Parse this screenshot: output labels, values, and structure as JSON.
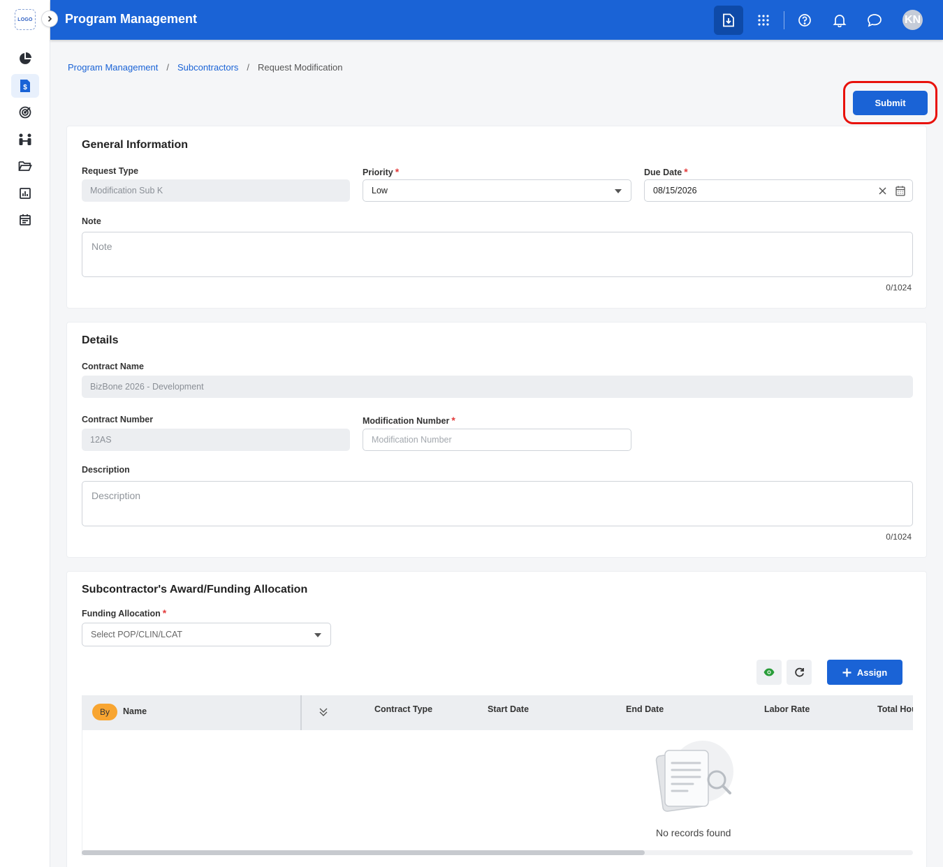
{
  "app": {
    "logo_text": "LOGO",
    "title": "Program Management"
  },
  "topbar": {
    "icons": [
      "download-file-icon",
      "apps-grid-icon",
      "help-icon",
      "bell-icon",
      "chat-icon"
    ],
    "avatar_initials": "KN",
    "accent_color": "#1a63d6"
  },
  "sidebar": {
    "items": [
      {
        "name": "dashboard-icon"
      },
      {
        "name": "contracts-icon",
        "active": true
      },
      {
        "name": "goals-icon"
      },
      {
        "name": "people-icon"
      },
      {
        "name": "folder-icon"
      },
      {
        "name": "reports-icon"
      },
      {
        "name": "calendar-icon"
      }
    ]
  },
  "breadcrumb": {
    "items": [
      "Program Management",
      "Subcontractors",
      "Request Modification"
    ],
    "separator": "/"
  },
  "actions": {
    "submit_label": "Submit"
  },
  "general_info": {
    "title": "General Information",
    "request_type": {
      "label": "Request Type",
      "value": "Modification Sub K"
    },
    "priority": {
      "label": "Priority",
      "value": "Low",
      "required_mark": "*"
    },
    "due_date": {
      "label": "Due Date",
      "value": "08/15/2026",
      "required_mark": "*"
    },
    "note": {
      "label": "Note",
      "placeholder": "Note",
      "counter": "0/1024"
    }
  },
  "details": {
    "title": "Details",
    "contract_name": {
      "label": "Contract Name",
      "value": "BizBone 2026 - Development"
    },
    "contract_number": {
      "label": "Contract Number",
      "value": "12AS"
    },
    "modification_number": {
      "label": "Modification Number",
      "placeholder": "Modification Number",
      "required_mark": "*"
    },
    "description": {
      "label": "Description",
      "placeholder": "Description",
      "counter": "0/1024"
    }
  },
  "funding": {
    "title": "Subcontractor's Award/Funding Allocation",
    "allocation": {
      "label": "Funding Allocation",
      "placeholder": "Select POP/CLIN/LCAT",
      "required_mark": "*"
    },
    "assign_label": "Assign",
    "table": {
      "by_badge": "By",
      "columns": [
        "Name",
        "Contract Type",
        "Start Date",
        "End Date",
        "Labor Rate",
        "Total Hours"
      ],
      "empty_text": "No records found"
    }
  }
}
